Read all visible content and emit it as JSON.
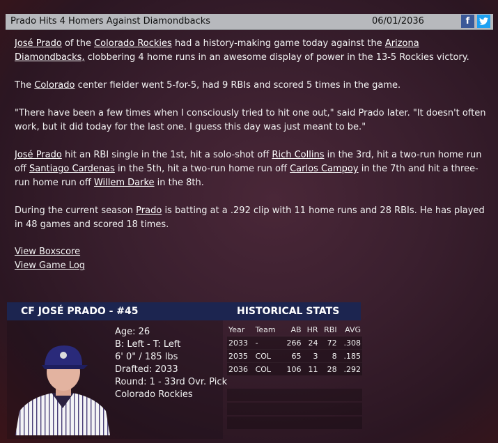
{
  "header": {
    "title": "Prado Hits 4 Homers Against Diamondbacks",
    "date": "06/01/2036",
    "facebook_icon": "f",
    "twitter_icon": "t"
  },
  "article": {
    "p1": {
      "player": "José Prado",
      "t1": " of the ",
      "team": "Colorado Rockies",
      "t2": " had a history-making game today against the ",
      "opponent": "Arizona Diamondbacks,",
      "t3": " clobbering 4 home runs in an awesome display of power in the 13-5 Rockies victory."
    },
    "p2": {
      "t1": "The ",
      "team": "Colorado",
      "t2": " center fielder went 5-for-5, had 9 RBIs and scored 5 times in the game."
    },
    "p3": "\"There have been a few times when I consciously tried to hit one out,\" said Prado later. \"It doesn't often work, but it did today for the last one. I guess this day was just meant to be.\"",
    "p4": {
      "player": "José Prado",
      "t1": " hit an RBI single in the 1st, hit a solo-shot off ",
      "pitcher1": "Rich Collins",
      "t2": " in the 3rd, hit a two-run home run off ",
      "pitcher2": "Santiago Cardenas",
      "t3": " in the 5th, hit a two-run home run off ",
      "pitcher3": "Carlos Campoy",
      "t4": " in the 7th and hit a three-run home run off ",
      "pitcher4": "Willem Darke",
      "t5": " in the 8th."
    },
    "p5": {
      "t1": "During the current season ",
      "player": "Prado",
      "t2": " is batting at a .292 clip with 11 home runs and 28 RBIs. He has played in 48 games and scored 18 times."
    }
  },
  "links": {
    "boxscore": "View Boxscore",
    "gamelog": "View Game Log"
  },
  "player": {
    "heading": "CF JOSÉ PRADO - #45",
    "age": "Age: 26",
    "bats_throws": "B: Left - T: Left",
    "size": "6' 0\" / 185 lbs",
    "drafted": "Drafted: 2033",
    "round": "Round: 1 - 33rd Ovr. Pick",
    "team": "Colorado Rockies"
  },
  "stats": {
    "heading": "HISTORICAL STATS",
    "columns": [
      "Year",
      "Team",
      "AB",
      "HR",
      "RBI",
      "AVG"
    ],
    "rows": [
      [
        "2033",
        "-",
        "266",
        "24",
        "72",
        ".308"
      ],
      [
        "2035",
        "COL",
        "65",
        "3",
        "8",
        ".185"
      ],
      [
        "2036",
        "COL",
        "106",
        "11",
        "28",
        ".292"
      ]
    ]
  },
  "colors": {
    "header_bg": "#b7b9bd",
    "panel_bar": "#1c2550",
    "facebook": "#3b5998",
    "twitter": "#1da1f2"
  }
}
